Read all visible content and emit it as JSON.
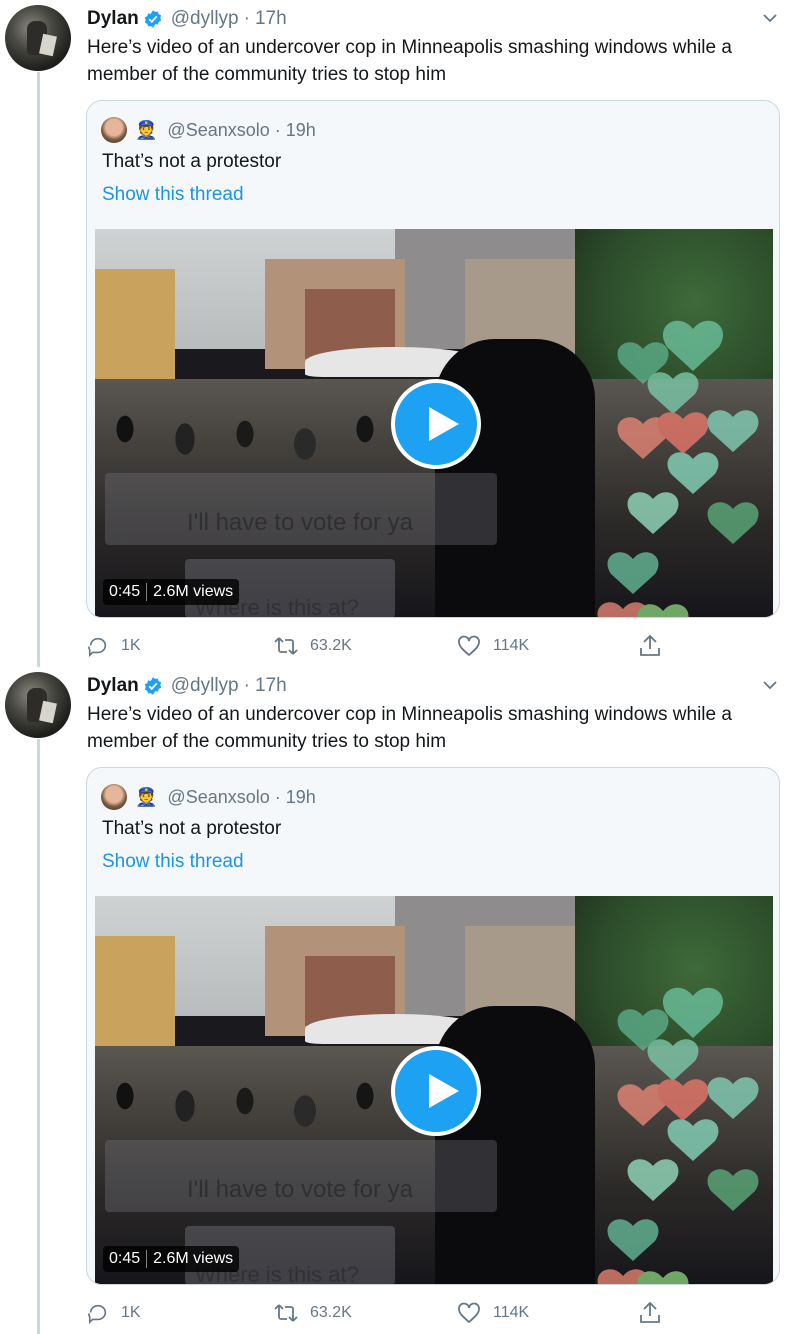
{
  "tweets": [
    {
      "author": {
        "name": "Dylan",
        "handle": "@dyllyp",
        "time": "17h",
        "verified": true
      },
      "text": "Here’s video of an undercover cop in Minneapolis smashing windows while a member of the community tries to stop him",
      "quote": {
        "handle": "@Seanxsolo",
        "time": "19h",
        "text": "That’s not a protestor",
        "show_thread": "Show this thread",
        "media": {
          "duration": "0:45",
          "views": "2.6M views",
          "overlay_text_1": "I'll have to vote for ya",
          "overlay_text_2": "Where is this at?"
        }
      },
      "actions": {
        "replies": "1K",
        "retweets": "63.2K",
        "likes": "114K"
      }
    },
    {
      "author": {
        "name": "Dylan",
        "handle": "@dyllyp",
        "time": "17h",
        "verified": true
      },
      "text": "Here’s video of an undercover cop in Minneapolis smashing windows while a member of the community tries to stop him",
      "quote": {
        "handle": "@Seanxsolo",
        "time": "19h",
        "text": "That’s not a protestor",
        "show_thread": "Show this thread",
        "media": {
          "duration": "0:45",
          "views": "2.6M views",
          "overlay_text_1": "I'll have to vote for ya",
          "overlay_text_2": "Where is this at?"
        }
      },
      "actions": {
        "replies": "1K",
        "retweets": "63.2K",
        "likes": "114K"
      }
    }
  ],
  "separator": "·",
  "icons": {
    "verified": "verified-badge-icon",
    "caret": "chevron-down-icon",
    "reply": "reply-icon",
    "retweet": "retweet-icon",
    "like": "heart-icon",
    "share": "share-icon",
    "play": "play-icon"
  },
  "colors": {
    "accent": "#1da1f2",
    "link": "#1b95e0",
    "muted": "#657786",
    "border": "#ccd6dd"
  }
}
